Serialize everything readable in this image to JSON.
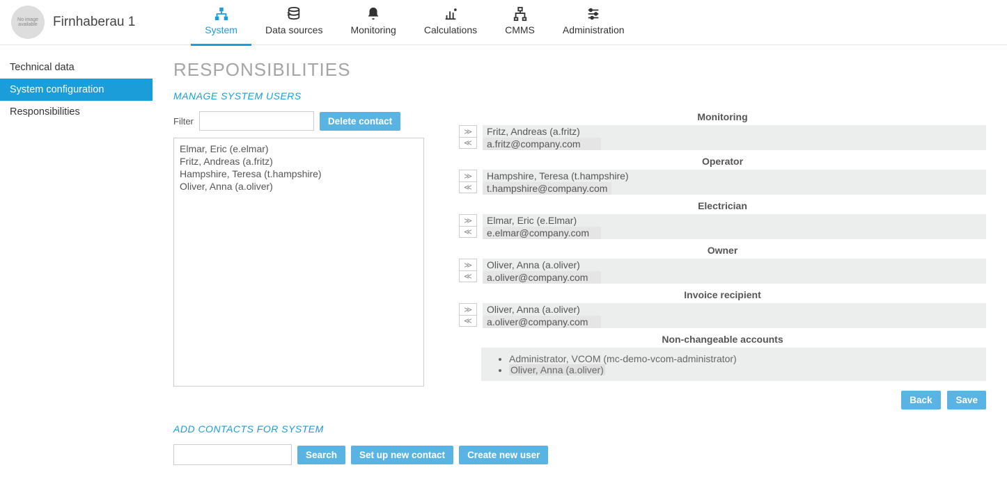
{
  "header": {
    "site_name": "Firnhaberau 1",
    "logo_text": "No image available",
    "tabs": [
      {
        "label": "System",
        "active": true
      },
      {
        "label": "Data sources"
      },
      {
        "label": "Monitoring"
      },
      {
        "label": "Calculations"
      },
      {
        "label": "CMMS"
      },
      {
        "label": "Administration"
      }
    ]
  },
  "sidebar": {
    "items": [
      {
        "label": "Technical data"
      },
      {
        "label": "System configuration",
        "active": true
      },
      {
        "label": "Responsibilities"
      }
    ]
  },
  "page": {
    "title": "RESPONSIBILITIES",
    "manage_title": "MANAGE SYSTEM USERS",
    "filter_label": "Filter",
    "delete_label": "Delete contact",
    "contacts": [
      "Elmar, Eric (e.elmar)",
      "Fritz, Andreas (a.fritz)",
      "Hampshire, Teresa (t.hampshire)",
      "Oliver, Anna (a.oliver)"
    ],
    "roles": [
      {
        "title": "Monitoring",
        "name": "Fritz, Andreas (a.fritz)",
        "email": "a.fritz@company.com"
      },
      {
        "title": "Operator",
        "name": "Hampshire, Teresa (t.hampshire)",
        "email": "t.hampshire@company.com"
      },
      {
        "title": "Electrician",
        "name": "Elmar, Eric (e.Elmar)",
        "email": "e.elmar@company.com"
      },
      {
        "title": "Owner",
        "name": "Oliver, Anna (a.oliver)",
        "email": "a.oliver@company.com"
      },
      {
        "title": "Invoice recipient",
        "name": "Oliver, Anna (a.oliver)",
        "email": "a.oliver@company.com"
      }
    ],
    "nonchangeable_title": "Non-changeable accounts",
    "nonchangeable": [
      "Administrator, VCOM (mc-demo-vcom-administrator)",
      "Oliver, Anna (a.oliver)"
    ],
    "back_label": "Back",
    "save_label": "Save",
    "add_title": "ADD CONTACTS FOR SYSTEM",
    "search_label": "Search",
    "setup_label": "Set up new contact",
    "create_label": "Create new user"
  }
}
